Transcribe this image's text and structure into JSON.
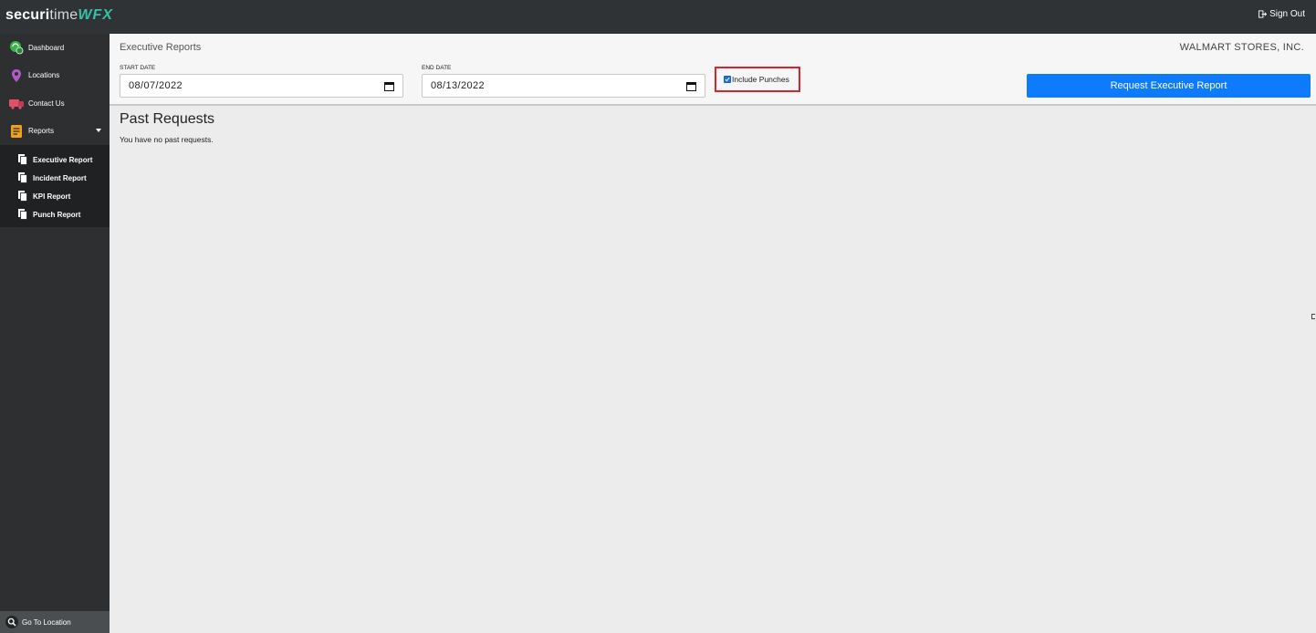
{
  "app": {
    "logo_part1": "securi",
    "logo_part2": "time",
    "logo_part3": "WFX",
    "sign_out": "Sign Out"
  },
  "sidebar": {
    "items": [
      {
        "label": "Dashboard",
        "icon": "dashboard-icon",
        "color": "#3bb34a"
      },
      {
        "label": "Locations",
        "icon": "location-pin-icon",
        "color": "#b05cc8"
      },
      {
        "label": "Contact Us",
        "icon": "contact-truck-icon",
        "color": "#e0506a"
      },
      {
        "label": "Reports",
        "icon": "reports-icon",
        "color": "#f0a020"
      }
    ],
    "sub_items": [
      {
        "label": "Executive Report",
        "icon": "document-icon"
      },
      {
        "label": "Incident Report",
        "icon": "document-icon"
      },
      {
        "label": "KPI Report",
        "icon": "document-icon"
      },
      {
        "label": "Punch Report",
        "icon": "document-icon"
      }
    ],
    "go_to_location": "Go To Location"
  },
  "header": {
    "title": "Executive Reports",
    "company": "WALMART STORES, INC.",
    "start_label": "START DATE",
    "start_value": "08/07/2022",
    "end_label": "END DATE",
    "end_value": "08/13/2022",
    "include_punches": "Include Punches",
    "include_punches_checked": true,
    "request_button": "Request Executive Report"
  },
  "main": {
    "past_title": "Past Requests",
    "past_text": "You have no past requests."
  },
  "colors": {
    "topbar": "#303335",
    "sidebar": "#2d2f31",
    "accent": "#0d7bfc",
    "highlight_border": "#d9232d",
    "logo_accent": "#36c0a8"
  }
}
